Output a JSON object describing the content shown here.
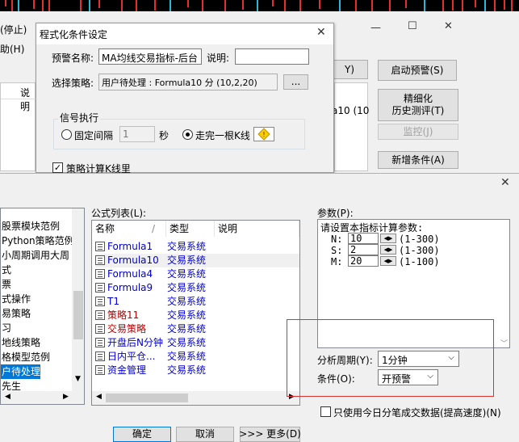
{
  "colors": {
    "accent": "#0078d7",
    "annotation_red": "#e03030",
    "formula_blue": "#0000cc",
    "formula_red": "#b00000"
  },
  "background_window": {
    "menu_left_1": "(停止)",
    "menu_left_2": "助(H)",
    "sys_min": "—",
    "sys_max": "☐",
    "sys_close": "✕",
    "col_header_left": "说明",
    "partial_button": "Y)",
    "start_alert_button": "启动预警(S)",
    "refine_button_line1": "精细化",
    "refine_button_line2": "历史测评(T)",
    "monitor_button": "监控(J)",
    "add_condition_button": "新增条件(A)",
    "formula_cell_text": "a10 (10"
  },
  "condition_dialog": {
    "title": "程式化条件设定",
    "close": "✕",
    "alert_name_label": "预警名称:",
    "alert_name_value": "MA均线交易指标-后台",
    "desc_label": "说明:",
    "desc_value": "",
    "strategy_label": "选择策略:",
    "strategy_value": "用户待处理 : Formula10 分 (10,2,20)",
    "browse_button": "...",
    "signal_group": "信号执行",
    "fixed_interval_label": "固定间隔",
    "interval_value": "1",
    "seconds_label": "秒",
    "after_kline_label": "走完一根K线",
    "kline_icon": "warning-diamond-icon",
    "strategy_check_label": "策略计算K线里"
  },
  "main_dialog": {
    "close": "✕",
    "formula_list_label": "公式列表(L):",
    "params_label": "参数(P):",
    "tree_items": [
      {
        "label": "股票模块范例",
        "selected": false
      },
      {
        "label": "Python策略范例",
        "selected": false
      },
      {
        "label": "小周期调用大周",
        "selected": false
      },
      {
        "label": "式",
        "selected": false
      },
      {
        "label": "票",
        "selected": false
      },
      {
        "label": "式操作",
        "selected": false
      },
      {
        "label": "易策略",
        "selected": false
      },
      {
        "label": "习",
        "selected": false
      },
      {
        "label": "地线策略",
        "selected": false
      },
      {
        "label": "格模型范例",
        "selected": false
      },
      {
        "label": "户待处理",
        "selected": true
      },
      {
        "label": "先生",
        "selected": false
      }
    ],
    "columns": {
      "name": "名称",
      "sort": "/",
      "type": "类型",
      "desc": "说明"
    },
    "formulas": [
      {
        "name": "Formula1",
        "type": "交易系统",
        "red": false
      },
      {
        "name": "Formula10",
        "type": "交易系统",
        "red": false
      },
      {
        "name": "Formula4",
        "type": "交易系统",
        "red": false
      },
      {
        "name": "Formula9",
        "type": "交易系统",
        "red": false
      },
      {
        "name": "T1",
        "type": "交易系统",
        "red": false
      },
      {
        "name": "策略11",
        "type": "交易系统",
        "red": true
      },
      {
        "name": "交易策略",
        "type": "交易系统",
        "red": true
      },
      {
        "name": "开盘后N分钟",
        "type": "交易系统",
        "red": false
      },
      {
        "name": "日内平仓...",
        "type": "交易系统",
        "red": false
      },
      {
        "name": "资金管理",
        "type": "交易系统",
        "red": false
      }
    ],
    "params_title": "请设置本指标计算参数:",
    "params": [
      {
        "name": "N:",
        "value": "10",
        "range": "(1-300)"
      },
      {
        "name": "S:",
        "value": "2",
        "range": "(1-300)"
      },
      {
        "name": "M:",
        "value": "20",
        "range": "(1-100)"
      }
    ],
    "period_label": "分析周期(Y):",
    "period_value": "1分钟",
    "condition_label": "条件(O):",
    "condition_value": "开预警",
    "today_only_label": "只使用今日分笔成交数据(提高速度)(N)",
    "ok_button": "确定",
    "cancel_button": "取消",
    "more_button": ">>> 更多(D)"
  }
}
